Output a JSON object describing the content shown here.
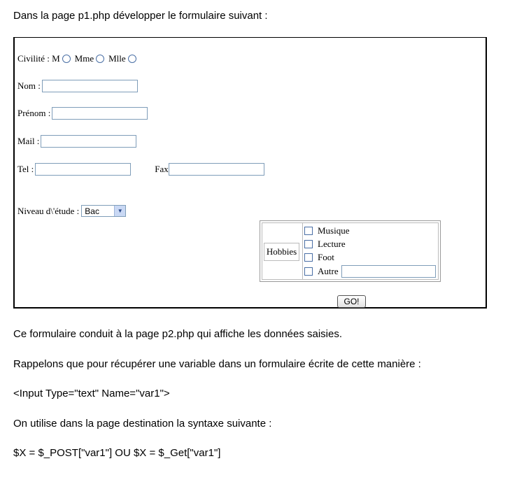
{
  "intro": "Dans la page p1.php développer le formulaire suivant :",
  "form": {
    "civilite_label": "Civilité : M",
    "mme_label": "Mme",
    "mlle_label": "Mlle",
    "nom_label": "Nom :",
    "prenom_label": "Prénom :",
    "mail_label": "Mail :",
    "tel_label": "Tel :",
    "fax_label": "Fax",
    "niveau_label": "Niveau d\\'étude :",
    "niveau_value": "Bac",
    "hobbies_label": "Hobbies",
    "hobbies": [
      "Musique",
      "Lecture",
      "Foot",
      "Autre"
    ],
    "go_label": "GO!"
  },
  "text": {
    "p1": "Ce formulaire conduit à la page p2.php qui affiche les données saisies.",
    "p2": "Rappelons que pour récupérer une variable dans un formulaire écrite de cette manière :",
    "p3": "<Input Type=\"text\" Name=\"var1\">",
    "p4": "On utilise dans la page destination la syntaxe suivante :",
    "p5": "$X = $_POST[\"var1\"] OU $X = $_Get[\"var1\"]"
  }
}
